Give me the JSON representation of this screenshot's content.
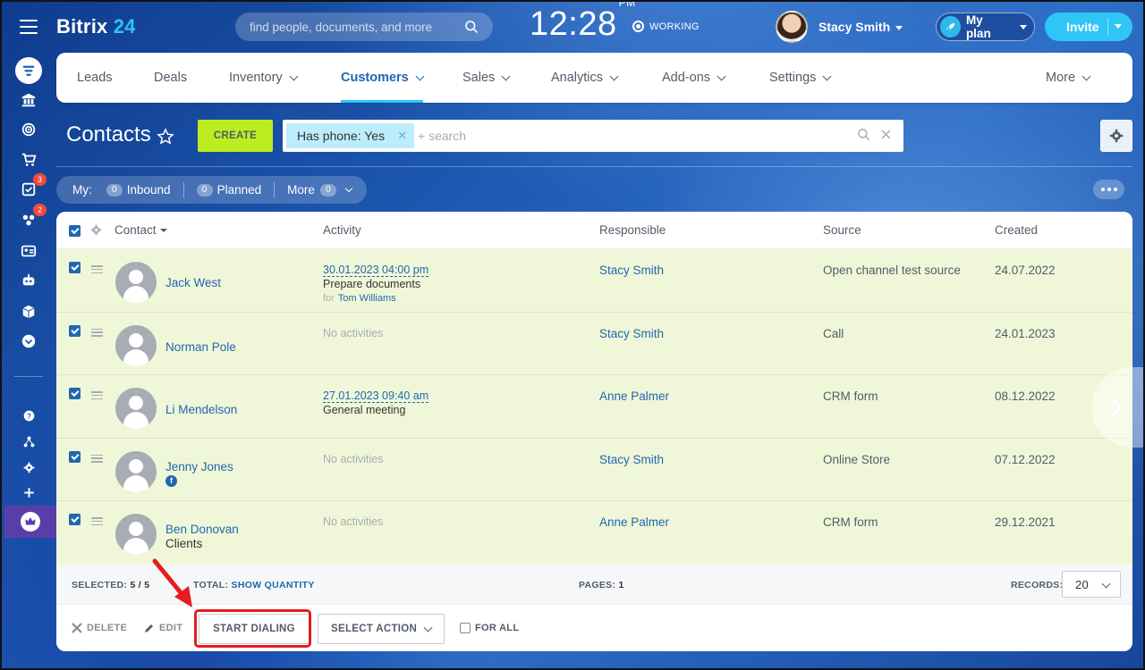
{
  "brand": {
    "name": "Bitrix",
    "num": "24",
    "accent": "#2fc6f6",
    "create_color": "#bbed21",
    "highlight": "#e41e1e"
  },
  "header": {
    "search_placeholder": "find people, documents, and more",
    "time": "12:28",
    "ampm": "PM",
    "status": "WORKING",
    "user_name": "Stacy Smith",
    "plan_label": "My plan",
    "invite_label": "Invite"
  },
  "sidebar": {
    "icons": [
      "menu-icon",
      "crm-filter-icon",
      "bank-icon",
      "target-icon",
      "cart-icon",
      "tasks-icon",
      "groups-icon",
      "contact-card-icon",
      "robot-icon",
      "box-icon",
      "more-down-icon",
      "help-icon",
      "sitemap-icon",
      "settings-icon",
      "plus-icon",
      "crown-icon"
    ],
    "badges": {
      "tasks": "3",
      "groups": "2"
    }
  },
  "nav": {
    "items": [
      {
        "label": "Leads"
      },
      {
        "label": "Deals"
      },
      {
        "label": "Inventory"
      },
      {
        "label": "Customers"
      },
      {
        "label": "Sales"
      },
      {
        "label": "Analytics"
      },
      {
        "label": "Add-ons"
      },
      {
        "label": "Settings"
      },
      {
        "label": "More"
      }
    ],
    "active": "Customers"
  },
  "page": {
    "title": "Contacts",
    "create_label": "CREATE",
    "filter_chip": "Has phone: Yes",
    "filter_search": "+ search"
  },
  "counters": {
    "my_label": "My:",
    "inbound_count": "0",
    "inbound_label": "Inbound",
    "planned_count": "0",
    "planned_label": "Planned",
    "more_label": "More",
    "more_count": "0"
  },
  "grid": {
    "columns": [
      "Contact",
      "Activity",
      "Responsible",
      "Source",
      "Created"
    ],
    "rows": [
      {
        "name": "Jack West",
        "sub": "",
        "activity_date": "30.01.2023 04:00 pm",
        "activity_text": "Prepare documents",
        "activity_for_label": "for",
        "activity_for": "Tom Williams",
        "no_activity": "",
        "responsible": "Stacy Smith",
        "source": "Open channel test source",
        "created": "24.07.2022"
      },
      {
        "name": "Norman Pole",
        "sub": "",
        "activity_date": "",
        "activity_text": "",
        "activity_for_label": "",
        "activity_for": "",
        "no_activity": "No activities",
        "responsible": "Stacy Smith",
        "source": "Call",
        "created": "24.01.2023"
      },
      {
        "name": "Li Mendelson",
        "sub": "",
        "activity_date": "27.01.2023 09:40 am",
        "activity_text": "General meeting",
        "activity_for_label": "",
        "activity_for": "",
        "no_activity": "",
        "responsible": "Anne Palmer",
        "source": "CRM form",
        "created": "08.12.2022"
      },
      {
        "name": "Jenny Jones",
        "sub": "",
        "activity_date": "",
        "activity_text": "",
        "activity_for_label": "",
        "activity_for": "",
        "no_activity": "No activities",
        "responsible": "Stacy Smith",
        "source": "Online Store",
        "created": "07.12.2022"
      },
      {
        "name": "Ben Donovan",
        "sub": "Clients",
        "activity_date": "",
        "activity_text": "",
        "activity_for_label": "",
        "activity_for": "",
        "no_activity": "No activities",
        "responsible": "Anne Palmer",
        "source": "CRM form",
        "created": "29.12.2021"
      }
    ]
  },
  "footer": {
    "selected_label": "SELECTED:",
    "selected_value": "5 / 5",
    "total_label": "TOTAL:",
    "total_link": "SHOW QUANTITY",
    "pages_label": "PAGES:",
    "pages_value": "1",
    "records_label": "RECORDS:",
    "records_value": "20",
    "delete_label": "DELETE",
    "edit_label": "EDIT",
    "dial_label": "START DIALING",
    "select_action_label": "SELECT ACTION",
    "for_all_label": "FOR ALL"
  }
}
